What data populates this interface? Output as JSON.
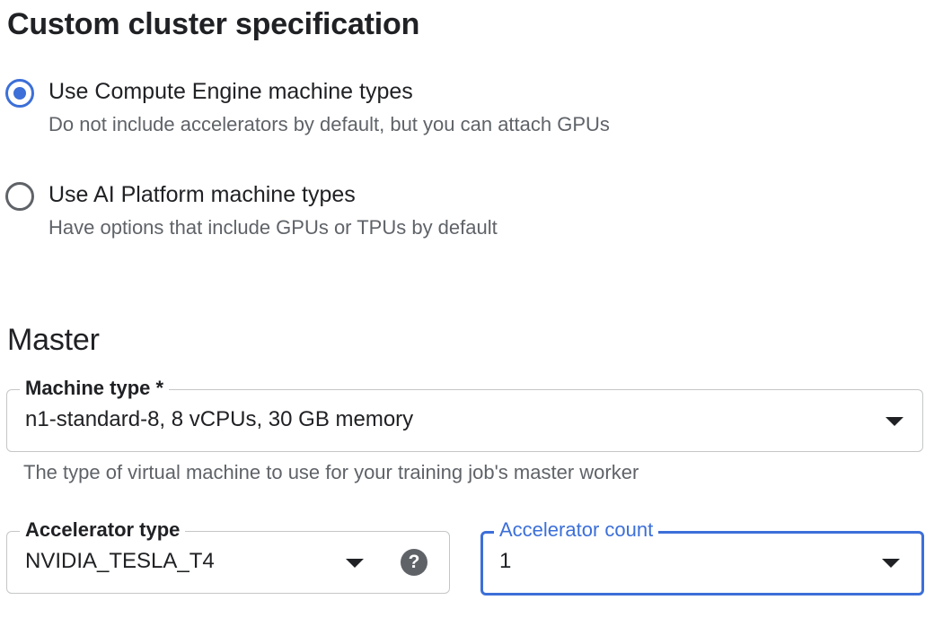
{
  "heading": "Custom cluster specification",
  "options": [
    {
      "label": "Use Compute Engine machine types",
      "description": "Do not include accelerators by default, but you can attach GPUs",
      "selected": true
    },
    {
      "label": "Use AI Platform machine types",
      "description": "Have options that include GPUs or TPUs by default",
      "selected": false
    }
  ],
  "master": {
    "title": "Master",
    "machine_type": {
      "label": "Machine type *",
      "value": "n1-standard-8, 8 vCPUs, 30 GB memory",
      "hint": "The type of virtual machine to use for your training job's master worker"
    },
    "accelerator_type": {
      "label": "Accelerator type",
      "value": "NVIDIA_TESLA_T4",
      "help_icon": "?"
    },
    "accelerator_count": {
      "label": "Accelerator count",
      "value": "1"
    }
  },
  "colors": {
    "accent": "#3c6fd8",
    "text": "#202124",
    "secondary_text": "#5f6368",
    "border": "#c4c7c5"
  },
  "icons": [
    "radio-checked-icon",
    "radio-unchecked-icon",
    "dropdown-arrow-icon",
    "help-icon"
  ]
}
